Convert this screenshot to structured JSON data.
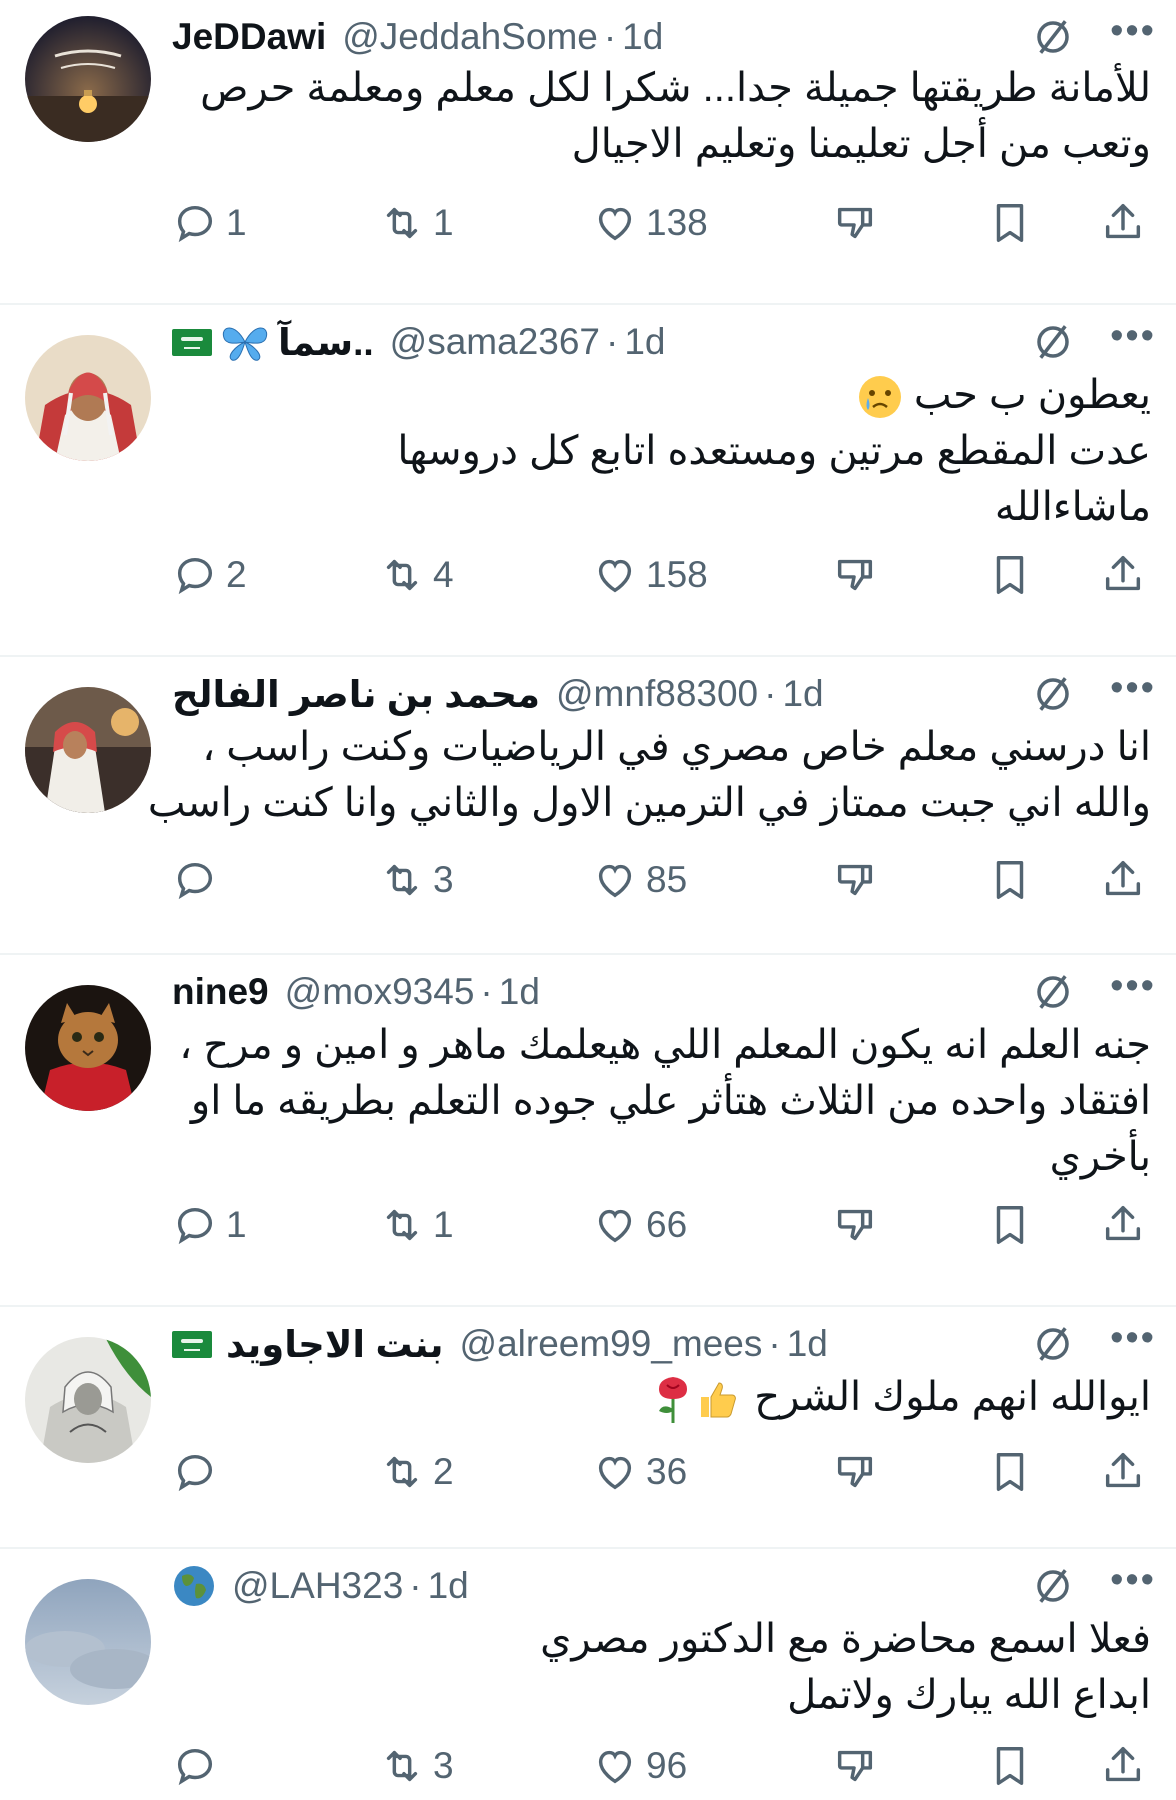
{
  "replies": [
    {
      "name": "JeDDawi",
      "handle": "@JeddahSome",
      "time": "1d",
      "lines": [
        "للأمانة طريقتها جميلة جدا... شكرا لكل معلم ومعلمة حرص",
        "وتعب من أجل تعليمنا وتعليم الاجيال"
      ],
      "replies": "1",
      "retweets": "1",
      "likes": "138"
    },
    {
      "name": "سمآ..",
      "handle": "@sama2367",
      "time": "1d",
      "lines": [
        "يعطون ب حب",
        "عدت المقطع مرتين ومستعده اتابع كل دروسها",
        "ماشاءالله"
      ],
      "replies": "2",
      "retweets": "4",
      "likes": "158"
    },
    {
      "name": "محمد بن ناصر الفالح",
      "handle": "@mnf88300",
      "time": "1d",
      "lines": [
        "انا درسني معلم خاص مصري في الرياضيات وكنت راسب ،",
        "والله اني جبت ممتاز في الترمين الاول والثاني وانا كنت راسب"
      ],
      "replies": "",
      "retweets": "3",
      "likes": "85"
    },
    {
      "name": "nine9",
      "handle": "@mox9345",
      "time": "1d",
      "lines": [
        "جنه العلم انه يكون المعلم اللي هيعلمك ماهر و امين و مرح ،",
        "افتقاد واحده من الثلاث هتأثر علي جوده التعلم بطريقه ما او",
        "بأخري"
      ],
      "replies": "1",
      "retweets": "1",
      "likes": "66"
    },
    {
      "name": "بنت الاجاويد",
      "handle": "@alreem99_mees",
      "time": "1d",
      "lines": [
        "ايوالله انهم ملوك الشرح"
      ],
      "replies": "",
      "retweets": "2",
      "likes": "36"
    },
    {
      "name": "",
      "handle": "@LAH323",
      "time": "1d",
      "lines": [
        "فعلا اسمع محاضرة مع الدكتور مصري",
        "ابداع الله يبارك ولاتمل"
      ],
      "replies": "",
      "retweets": "3",
      "likes": "96"
    }
  ],
  "icons": {
    "reply": "reply-icon",
    "retweet": "retweet-icon",
    "like": "heart-icon",
    "downvote": "downvote-icon",
    "bookmark": "bookmark-icon",
    "share": "share-icon",
    "grok": "grok-icon",
    "more": "more-icon"
  },
  "colors": {
    "text": "#0f1419",
    "secondary": "#536471",
    "divider": "#eff3f4"
  }
}
